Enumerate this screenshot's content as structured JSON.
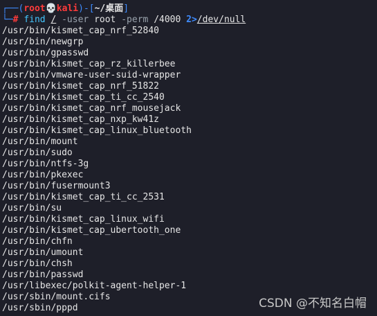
{
  "prompt": {
    "corner_top": "┌──(",
    "user": "root",
    "skull": "💀",
    "host": "kali",
    "mid": ")-[",
    "cwd": "~/桌面",
    "end": "]",
    "corner_bottom": "└─",
    "hash": "#",
    "command": {
      "cmd": "find",
      "path": "/",
      "flag1": "-user",
      "arg1": "root",
      "flag2": "-perm",
      "arg2": "/4000",
      "redir": "2>",
      "target": "/dev/null"
    }
  },
  "output": [
    "/usr/bin/kismet_cap_nrf_52840",
    "/usr/bin/newgrp",
    "/usr/bin/gpasswd",
    "/usr/bin/kismet_cap_rz_killerbee",
    "/usr/bin/vmware-user-suid-wrapper",
    "/usr/bin/kismet_cap_nrf_51822",
    "/usr/bin/kismet_cap_ti_cc_2540",
    "/usr/bin/kismet_cap_nrf_mousejack",
    "/usr/bin/kismet_cap_nxp_kw41z",
    "/usr/bin/kismet_cap_linux_bluetooth",
    "/usr/bin/mount",
    "/usr/bin/sudo",
    "/usr/bin/ntfs-3g",
    "/usr/bin/pkexec",
    "/usr/bin/fusermount3",
    "/usr/bin/kismet_cap_ti_cc_2531",
    "/usr/bin/su",
    "/usr/bin/kismet_cap_linux_wifi",
    "/usr/bin/kismet_cap_ubertooth_one",
    "/usr/bin/chfn",
    "/usr/bin/umount",
    "/usr/bin/chsh",
    "/usr/bin/passwd",
    "/usr/libexec/polkit-agent-helper-1",
    "/usr/sbin/mount.cifs",
    "/usr/sbin/pppd"
  ],
  "watermark": "CSDN @不知名白帽",
  "colors": {
    "background": "#1e1f29",
    "prompt_frame": "#3f8cff",
    "root_user": "#ff3b3b",
    "command": "#44c7ff"
  }
}
